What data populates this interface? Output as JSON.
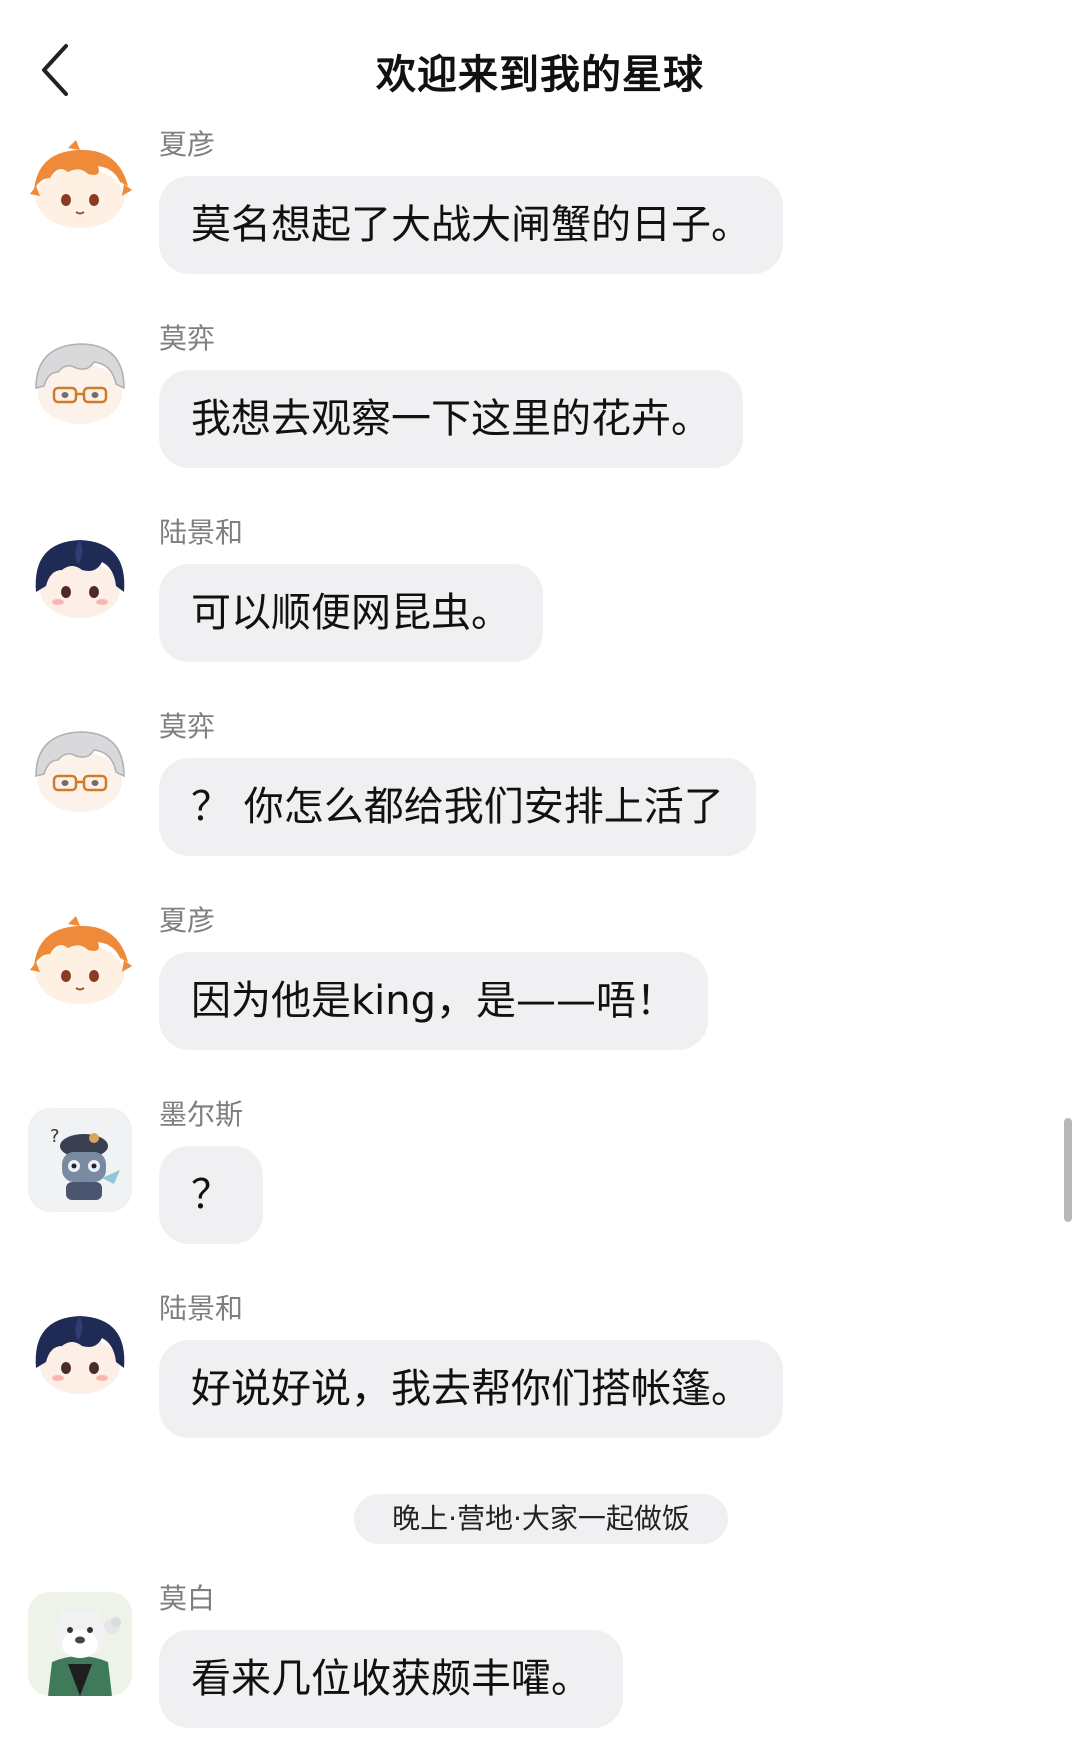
{
  "header": {
    "title": "欢迎来到我的星球",
    "back_icon": "chevron-left-icon"
  },
  "messages": [
    {
      "sender": "夏彦",
      "text": "莫名想起了大战大闸蟹的日子。",
      "avatar": "orange-hair-avatar"
    },
    {
      "sender": "莫弈",
      "text": "我想去观察一下这里的花卉。",
      "avatar": "silver-hair-glasses-avatar"
    },
    {
      "sender": "陆景和",
      "text": "可以顺便网昆虫。",
      "avatar": "navy-hair-avatar"
    },
    {
      "sender": "莫弈",
      "text": "？ 你怎么都给我们安排上活了",
      "avatar": "silver-hair-glasses-avatar"
    },
    {
      "sender": "夏彦",
      "text": "因为他是king，是——唔！",
      "avatar": "orange-hair-avatar"
    },
    {
      "sender": "墨尔斯",
      "text": "？",
      "avatar": "robot-question-avatar"
    },
    {
      "sender": "陆景和",
      "text": "好说好说，我去帮你们搭帐篷。",
      "avatar": "navy-hair-avatar"
    },
    {
      "sender": "莫白",
      "text": "看来几位收获颇丰嚯。",
      "avatar": "white-beast-avatar"
    }
  ],
  "scene_divider": "晚上·营地·大家一起做饭",
  "colors": {
    "bubble": "#f0f0f2",
    "sender_text": "#7f7f7f",
    "orange_hair": "#ee8a3a",
    "silver_hair": "#d9d9dc",
    "navy_hair": "#1f2a55"
  }
}
